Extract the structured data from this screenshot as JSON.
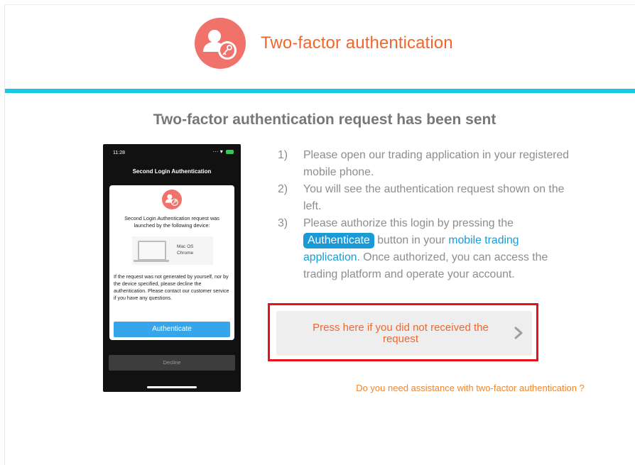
{
  "header": {
    "title": "Two-factor authentication",
    "brand_color": "#f1716b",
    "accent_bar_color": "#17c7e6",
    "logo_icon": "user-key-icon"
  },
  "main": {
    "subtitle": "Two-factor authentication request has been sent"
  },
  "phone": {
    "status_time": "11:28",
    "title": "Second Login Authentication",
    "message": "Second Login Authentication request was launched by the following device:",
    "device_os": "Mac OS",
    "device_browser": "Chrome",
    "note": "If the request was not generated by yourself, nor by the device specified, please decline the authentication. Please contact our customer service if you have any questions.",
    "authenticate_label": "Authenticate",
    "decline_label": "Decline"
  },
  "steps": [
    {
      "num": "1)",
      "text": "Please open our trading application in your registered mobile phone."
    },
    {
      "num": "2)",
      "text": "You will see the authentication request shown on the left."
    },
    {
      "num": "3)",
      "pre": "Please authorize this login by pressing the",
      "chip": "Authenticate",
      "mid": "button in your",
      "link": "mobile trading application",
      "post": ". Once authorized, you can access the trading platform and operate your account."
    }
  ],
  "not_received": {
    "label": "Press here if you did not received the request",
    "highlight_color": "#e4141b"
  },
  "assist_link": "Do you need assistance with two-factor authentication ?"
}
